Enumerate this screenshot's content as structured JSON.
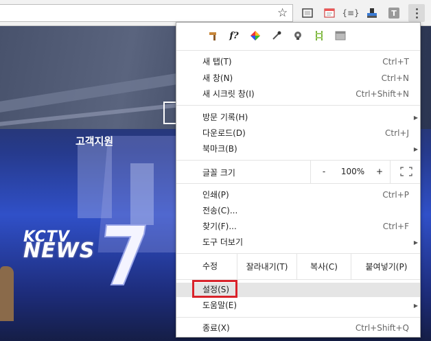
{
  "page": {
    "support_label": "고객지원",
    "logo_small": "KCTV",
    "logo_big": "NEWS",
    "logo_number": "7"
  },
  "toolbar": {
    "icons": [
      "star-icon",
      "screenshot-icon",
      "calendar-icon",
      "json-icon",
      "stamp-icon",
      "t-icon",
      "menu-icon"
    ]
  },
  "menu": {
    "extensions": [
      "hammer-icon",
      "font-icon",
      "color-icon",
      "eyedropper-icon",
      "bulb-icon",
      "ruler-icon",
      "window-icon"
    ],
    "items": [
      {
        "label": "새 탭(T)",
        "shortcut": "Ctrl+T"
      },
      {
        "label": "새 창(N)",
        "shortcut": "Ctrl+N"
      },
      {
        "label": "새 시크릿 창(I)",
        "shortcut": "Ctrl+Shift+N"
      },
      {
        "label": "방문 기록(H)",
        "shortcut": ""
      },
      {
        "label": "다운로드(D)",
        "shortcut": "Ctrl+J"
      },
      {
        "label": "북마크(B)",
        "shortcut": ""
      },
      {
        "label": "인쇄(P)",
        "shortcut": "Ctrl+P"
      },
      {
        "label": "전송(C)...",
        "shortcut": ""
      },
      {
        "label": "찾기(F)...",
        "shortcut": "Ctrl+F"
      },
      {
        "label": "도구 더보기",
        "shortcut": ""
      },
      {
        "label": "설정(S)",
        "shortcut": ""
      },
      {
        "label": "도움말(E)",
        "shortcut": ""
      },
      {
        "label": "종료(X)",
        "shortcut": "Ctrl+Shift+Q"
      }
    ],
    "zoom": {
      "label": "글꼴 크기",
      "minus": "-",
      "value": "100%",
      "plus": "+"
    },
    "edit": {
      "label": "수정",
      "cut": "잘라내기(T)",
      "copy": "복사(C)",
      "paste": "붙여넣기(P)"
    },
    "highlight_color": "#d9222a"
  }
}
